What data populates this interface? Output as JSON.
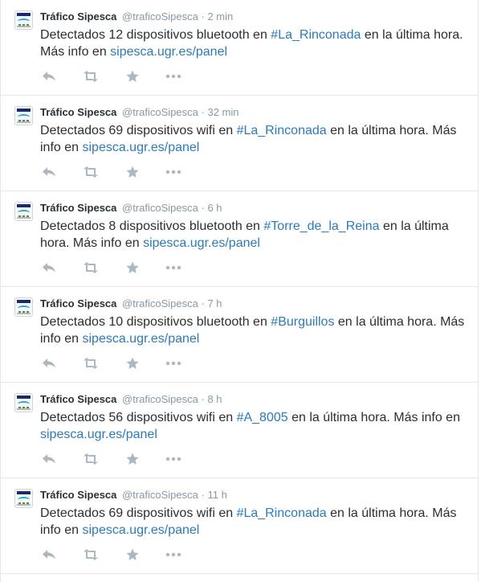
{
  "tweets": [
    {
      "name": "Tráfico Sipesca",
      "handle": "@traficoSipesca",
      "sep": "·",
      "time": "2 min",
      "pre": "Detectados 12 dispositivos bluetooth en ",
      "hashtag": "#La_Rinconada",
      "post": " en la última hora. Más info en ",
      "link": "sipesca.ugr.es/panel"
    },
    {
      "name": "Tráfico Sipesca",
      "handle": "@traficoSipesca",
      "sep": "·",
      "time": "32 min",
      "pre": "Detectados 69 dispositivos wifi en ",
      "hashtag": "#La_Rinconada",
      "post": " en la última hora. Más info en ",
      "link": "sipesca.ugr.es/panel"
    },
    {
      "name": "Tráfico Sipesca",
      "handle": "@traficoSipesca",
      "sep": "·",
      "time": "6 h",
      "pre": "Detectados 8 dispositivos bluetooth en ",
      "hashtag": "#Torre_de_la_Reina",
      "post": " en la última hora. Más info en ",
      "link": "sipesca.ugr.es/panel"
    },
    {
      "name": "Tráfico Sipesca",
      "handle": "@traficoSipesca",
      "sep": "·",
      "time": "7 h",
      "pre": "Detectados 10 dispositivos bluetooth en ",
      "hashtag": "#Burguillos",
      "post": " en la última hora. Más info en ",
      "link": "sipesca.ugr.es/panel"
    },
    {
      "name": "Tráfico Sipesca",
      "handle": "@traficoSipesca",
      "sep": "·",
      "time": "8 h",
      "pre": "Detectados 56 dispositivos wifi en ",
      "hashtag": "#A_8005",
      "post": " en la última hora. Más info en ",
      "link": "sipesca.ugr.es/panel"
    },
    {
      "name": "Tráfico Sipesca",
      "handle": "@traficoSipesca",
      "sep": "·",
      "time": "11 h",
      "pre": "Detectados 69 dispositivos wifi en ",
      "hashtag": "#La_Rinconada",
      "post": " en la última hora. Más info en ",
      "link": "sipesca.ugr.es/panel"
    }
  ],
  "colors": {
    "text": "#292f33",
    "meta": "#8899a6",
    "link": "#2b7bb9",
    "icon": "#aab8c2",
    "border": "#e1e8ed"
  },
  "icons": {
    "reply": "reply-icon",
    "retweet": "retweet-icon",
    "favorite": "star-icon",
    "more": "more-icon"
  }
}
